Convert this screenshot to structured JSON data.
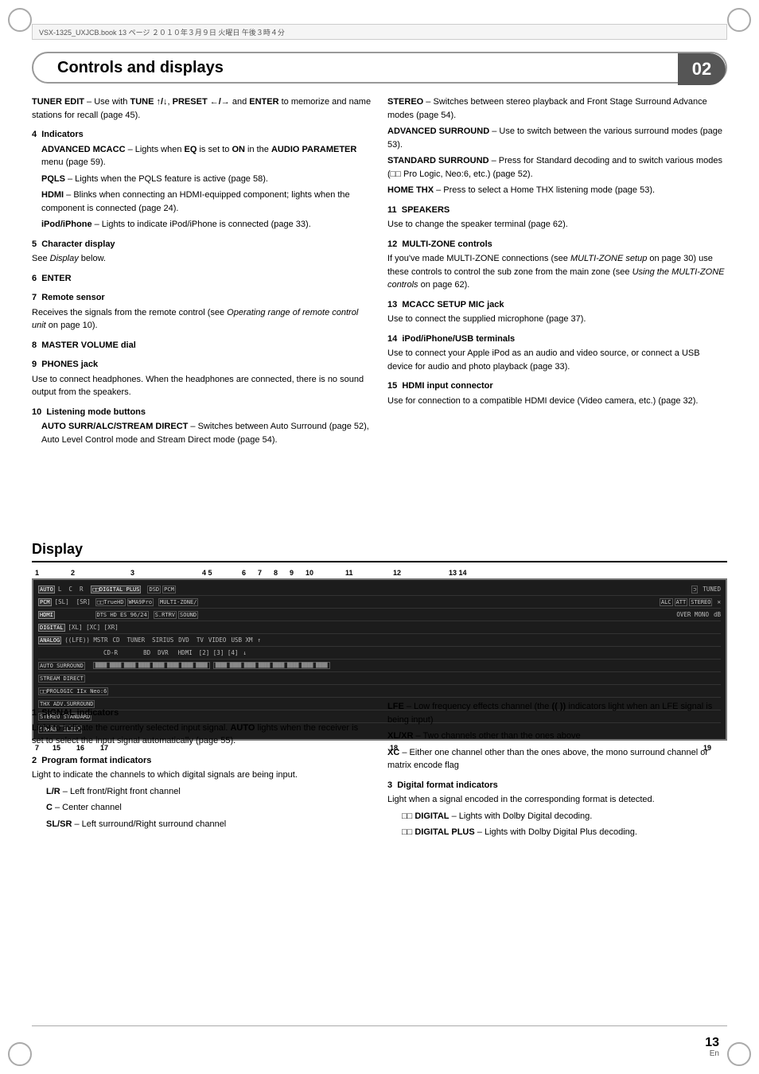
{
  "header": {
    "strip_text": "VSX-1325_UXJCB.book   13 ページ   ２０１０年３月９日   火曜日   午後３時４分"
  },
  "title": {
    "text": "Controls and displays",
    "chapter": "02"
  },
  "left_col": {
    "items": [
      {
        "type": "text",
        "content": "TUNER EDIT – Use with TUNE ↑/↓, PRESET ←/→ and ENTER to memorize and name stations for recall (page 45)."
      },
      {
        "type": "heading",
        "num": "4",
        "label": "Indicators"
      },
      {
        "type": "sub-bold",
        "label": "ADVANCED MCACC",
        "content": " – Lights when EQ is set to ON in the AUDIO PARAMETER menu (page 59)."
      },
      {
        "type": "sub-bold",
        "label": "PQLS",
        "content": " – Lights when the PQLS feature is active (page 58)."
      },
      {
        "type": "sub-bold",
        "label": "HDMI",
        "content": " – Blinks when connecting an HDMI-equipped component; lights when the component is connected (page 24)."
      },
      {
        "type": "sub-bold",
        "label": "iPod/iPhone",
        "content": " – Lights to indicate iPod/iPhone is connected (page 33)."
      },
      {
        "type": "heading",
        "num": "5",
        "label": "Character display"
      },
      {
        "type": "text",
        "content": "See Display below."
      },
      {
        "type": "heading",
        "num": "6",
        "label": "ENTER"
      },
      {
        "type": "heading",
        "num": "7",
        "label": "Remote sensor"
      },
      {
        "type": "text",
        "content": "Receives the signals from the remote control (see Operating range of remote control unit on page 10)."
      },
      {
        "type": "heading",
        "num": "8",
        "label": "MASTER VOLUME dial"
      },
      {
        "type": "heading",
        "num": "9",
        "label": "PHONES jack"
      },
      {
        "type": "text",
        "content": "Use to connect headphones. When the headphones are connected, there is no sound output from the speakers."
      },
      {
        "type": "heading",
        "num": "10",
        "label": "Listening mode buttons"
      },
      {
        "type": "sub-bold",
        "label": "AUTO SURR/ALC/STREAM DIRECT",
        "content": " – Switches between Auto Surround (page 52), Auto Level Control mode and Stream Direct mode (page 54)."
      }
    ]
  },
  "right_col": {
    "items": [
      {
        "type": "sub-bold",
        "label": "STEREO",
        "content": " – Switches between stereo playback and Front Stage Surround Advance modes (page 54)."
      },
      {
        "type": "sub-bold",
        "label": "ADVANCED SURROUND",
        "content": " – Use to switch between the various surround modes (page 53)."
      },
      {
        "type": "sub-bold",
        "label": "STANDARD SURROUND",
        "content": " – Press for Standard decoding and to switch various modes (□□ Pro Logic, Neo:6, etc.) (page 52)."
      },
      {
        "type": "sub-bold",
        "label": "HOME THX",
        "content": " – Press to select a Home THX listening mode (page 53)."
      },
      {
        "type": "heading",
        "num": "11",
        "label": "SPEAKERS"
      },
      {
        "type": "text",
        "content": "Use to change the speaker terminal (page 62)."
      },
      {
        "type": "heading",
        "num": "12",
        "label": "MULTI-ZONE controls"
      },
      {
        "type": "text",
        "content": "If you've made MULTI-ZONE connections (see MULTI-ZONE setup on page 30) use these controls to control the sub zone from the main zone (see Using the MULTI-ZONE controls on page 62)."
      },
      {
        "type": "heading",
        "num": "13",
        "label": "MCACC SETUP MIC jack"
      },
      {
        "type": "text",
        "content": "Use to connect the supplied microphone (page 37)."
      },
      {
        "type": "heading",
        "num": "14",
        "label": "iPod/iPhone/USB terminals"
      },
      {
        "type": "text",
        "content": "Use to connect your Apple iPod as an audio and video source, or connect a USB device for audio and photo playback (page 33)."
      },
      {
        "type": "heading",
        "num": "15",
        "label": "HDMI input connector"
      },
      {
        "type": "text",
        "content": "Use for connection to a compatible HDMI device (Video camera, etc.) (page 32)."
      }
    ]
  },
  "display_section": {
    "title": "Display",
    "diagram_numbers_top": [
      "1",
      "2",
      "",
      "3",
      "",
      "",
      "4 5",
      "6",
      "7",
      "8",
      "9",
      "10",
      "11",
      "",
      "12",
      "",
      "13 14"
    ],
    "diagram_numbers_bottom": [
      "7",
      "15",
      "16",
      "17",
      "",
      "",
      "",
      "18",
      "",
      "",
      "",
      "",
      "",
      "",
      "",
      "19"
    ],
    "display_rows": [
      [
        "AUTO",
        "L  C  R",
        "□□DIGITAL PLUS",
        "DSD  PCM",
        "",
        "",
        "",
        "⊃",
        "TUNED"
      ],
      [
        "PCM",
        "[SL]  [SR]",
        "□□TrueHD WMA9Pro",
        "MULTI-ZONE/",
        "ALC",
        "ATT  STEREO",
        "×",
        ""
      ],
      [
        "HDMI",
        "",
        "DTS HD ES 96/24",
        "S.RTRV  SOUND",
        "",
        "OVER  MONO",
        "",
        "dB"
      ],
      [
        "DIGITAL",
        "[XL] [XC] [XR]",
        "",
        "",
        "",
        "",
        "",
        ""
      ],
      [
        "ANALOG",
        "((LFE))  MSTR",
        "CD   TUNER   SIRIUS",
        "DVD   TV",
        "VIDEO",
        "USB XM",
        "↑"
      ],
      [
        "",
        "",
        "CD-R",
        "BD   DVR",
        "HDMI",
        "[2] [3] [4]",
        "↓"
      ],
      [
        "AUTO SURROUND",
        "",
        "",
        "",
        "",
        "",
        ""
      ],
      [
        "STREAM DIRECT",
        "",
        "",
        "",
        "",
        "",
        ""
      ],
      [
        "□□PROLOGIC IIx Neo:6",
        "",
        "",
        "",
        "",
        "",
        ""
      ],
      [
        "THX  ADV.SURROUND",
        "",
        "",
        "",
        "",
        "",
        ""
      ],
      [
        "STEREO STANDARD",
        "",
        "",
        "",
        "",
        "",
        ""
      ],
      [
        "SP▶AB  SLEEP",
        "",
        "",
        "",
        "",
        "",
        ""
      ]
    ],
    "seg_blocks": true
  },
  "bottom_left": {
    "sections": [
      {
        "num": "1",
        "label": "SIGNAL indicators",
        "text": "Light to indicate the currently selected input signal. AUTO lights when the receiver is set to select the input signal automatically (page 55)."
      },
      {
        "num": "2",
        "label": "Program format indicators",
        "text": "Light to indicate the channels to which digital signals are being input.",
        "sub": [
          "L/R – Left front/Right front channel",
          "C – Center channel",
          "SL/SR – Left surround/Right surround channel"
        ]
      }
    ]
  },
  "bottom_right": {
    "sections": [
      {
        "label": "LFE",
        "text": " – Low frequency effects channel (the (( )) indicators light when an LFE signal is being input)"
      },
      {
        "label": "XL/XR",
        "text": " – Two channels other than the ones above"
      },
      {
        "label": "XC",
        "text": " – Either one channel other than the ones above, the mono surround channel or matrix encode flag"
      },
      {
        "num": "3",
        "label": "Digital format indicators",
        "text": "Light when a signal encoded in the corresponding format is detected.",
        "sub": [
          "□□ DIGITAL – Lights with Dolby Digital decoding.",
          "□□ DIGITAL PLUS – Lights with Dolby Digital Plus decoding."
        ]
      }
    ]
  },
  "page": {
    "number": "13",
    "lang": "En"
  }
}
